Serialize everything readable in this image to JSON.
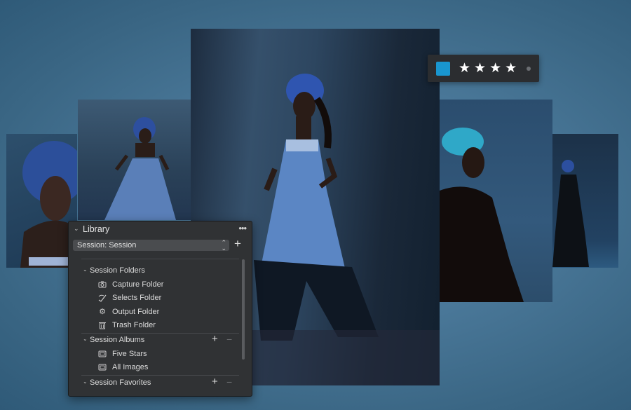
{
  "rating_bar": {
    "color_label": "#1996cf",
    "stars": [
      "★",
      "★",
      "★",
      "★"
    ],
    "rating": 4
  },
  "library": {
    "title": "Library",
    "more_glyph": "•••",
    "session_select": {
      "value": "Session: Session",
      "arrows": "⌃⌄"
    },
    "add_glyph": "+",
    "sections": [
      {
        "label": "Session Folders",
        "items": [
          {
            "label": "Capture Folder",
            "icon": "camera-icon"
          },
          {
            "label": "Selects Folder",
            "icon": "selects-icon"
          },
          {
            "label": "Output Folder",
            "icon": "gear-icon"
          },
          {
            "label": "Trash Folder",
            "icon": "trash-icon"
          }
        ]
      },
      {
        "label": "Session Albums",
        "items": [
          {
            "label": "Five Stars",
            "icon": "smart-album-icon"
          },
          {
            "label": "All Images",
            "icon": "smart-album-icon"
          }
        ]
      },
      {
        "label": "Session Favorites",
        "items": []
      }
    ],
    "add_label": "+",
    "minus_label": "−"
  },
  "colors": {
    "background": "#4a7899",
    "panel": "#303234",
    "accent": "#1996cf"
  }
}
